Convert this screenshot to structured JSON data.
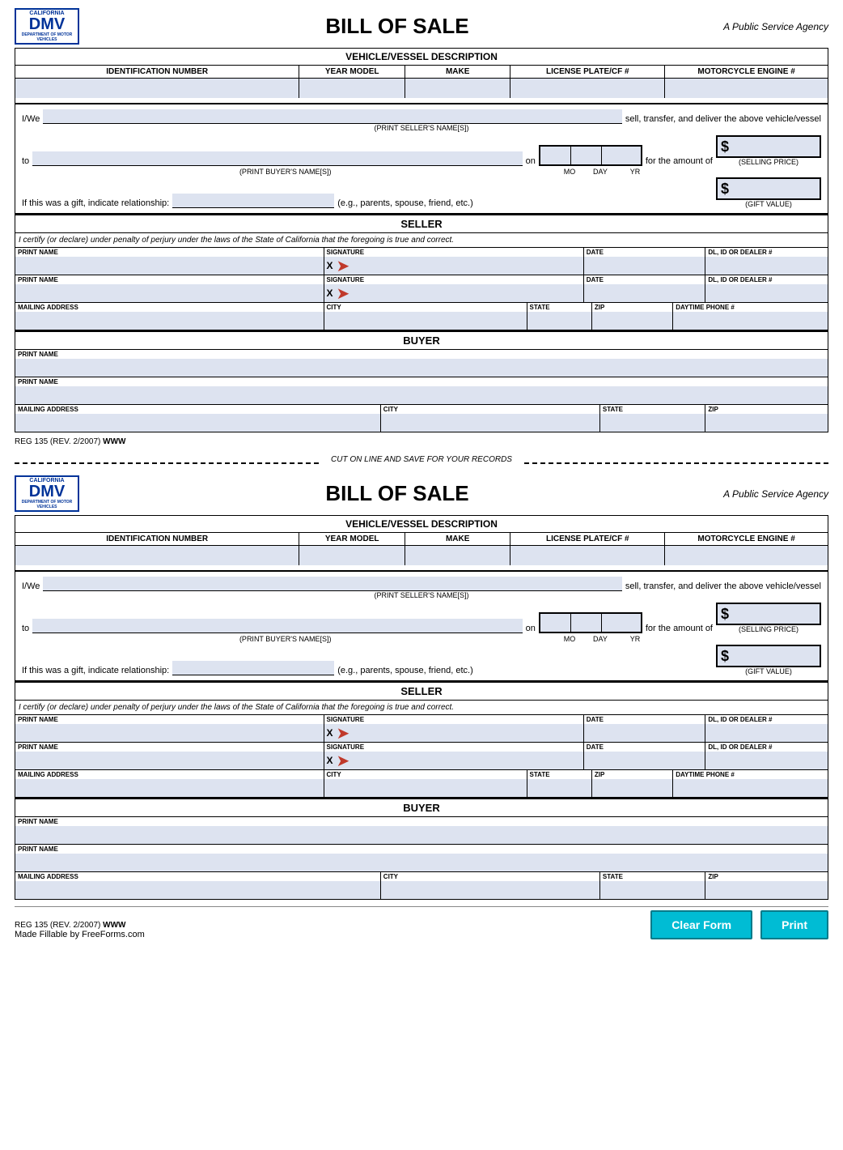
{
  "header": {
    "title": "BILL OF SALE",
    "subtitle": "A Public Service Agency",
    "logo_line1": "CALIFORNIA",
    "logo_main": "DMV",
    "logo_line2": "DEPARTMENT OF MOTOR VEHICLES"
  },
  "vehicle_desc": {
    "section_title": "VEHICLE/VESSEL DESCRIPTION",
    "col1": "IDENTIFICATION NUMBER",
    "col2": "YEAR MODEL",
    "col3": "MAKE",
    "col4": "LICENSE PLATE/CF #",
    "col5": "MOTORCYCLE ENGINE #"
  },
  "middle": {
    "iwe_prefix": "I/We",
    "iwe_suffix": "sell, transfer, and deliver the above vehicle/vessel",
    "seller_name_label": "(PRINT SELLER'S NAME[S])",
    "to_label": "to",
    "on_label": "on",
    "buyer_name_label": "(PRINT BUYER'S NAME[S])",
    "date_mo": "MO",
    "date_day": "DAY",
    "date_yr": "YR",
    "for_amount_label": "for  the amount of",
    "dollar_sign": "$",
    "selling_price_label": "(SELLING PRICE)",
    "gift_label": "If this was a gift, indicate relationship:",
    "gift_eg": "(e.g., parents, spouse, friend, etc.)",
    "gift_value_label": "(GIFT VALUE)"
  },
  "seller": {
    "section_title": "SELLER",
    "perjury_text": "I certify (or declare) under penalty of perjury under the laws of the State of California that the foregoing is true and correct.",
    "row1": {
      "print_name_label": "PRINT NAME",
      "signature_label": "SIGNATURE",
      "date_label": "DATE",
      "dl_label": "DL, ID OR DEALER #"
    },
    "row2": {
      "print_name_label": "PRINT NAME",
      "signature_label": "SIGNATURE",
      "date_label": "DATE",
      "dl_label": "DL, ID OR DEALER #"
    },
    "row3": {
      "mailing_label": "MAILING ADDRESS",
      "city_label": "CITY",
      "state_label": "STATE",
      "zip_label": "ZIP",
      "phone_label": "DAYTIME PHONE #"
    }
  },
  "buyer": {
    "section_title": "BUYER",
    "row1": {
      "print_name_label": "PRINT NAME"
    },
    "row2": {
      "print_name_label": "PRINT NAME"
    },
    "row3": {
      "mailing_label": "MAILING ADDRESS",
      "city_label": "CITY",
      "state_label": "STATE",
      "zip_label": "ZIP"
    }
  },
  "footer": {
    "reg_text": "REG 135 (REV. 2/2007)",
    "www_text": "WWW"
  },
  "cut_line": {
    "text": "CUT ON LINE AND SAVE FOR YOUR RECORDS"
  },
  "bottom_footer": {
    "reg_text": "REG 135 (REV. 2/2007)",
    "www_text": "WWW",
    "freeforms_text": "Made Fillable by FreeForms.com"
  },
  "buttons": {
    "clear_form": "Clear Form",
    "print": "Print"
  }
}
